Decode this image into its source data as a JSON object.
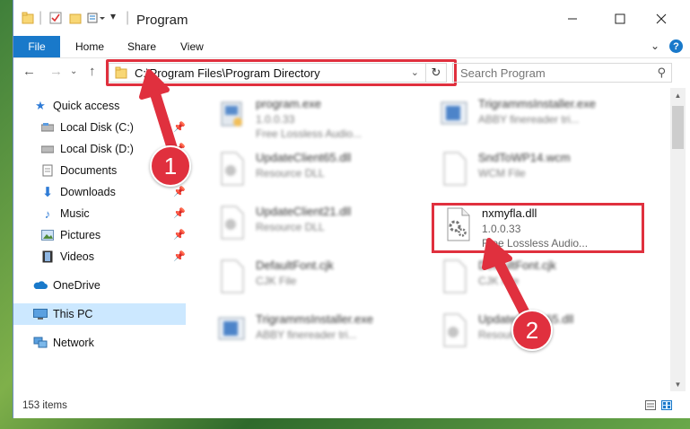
{
  "window": {
    "title": "Program",
    "controls": [
      "minimize-icon",
      "maximize-icon",
      "close-icon"
    ]
  },
  "ribbon": {
    "tabs": [
      "File",
      "Home",
      "Share",
      "View"
    ]
  },
  "navigation": {
    "address": "C:\\Program Files\\Program Directory",
    "search_placeholder": "Search Program"
  },
  "sidebar": {
    "items": [
      {
        "label": "Quick access",
        "icon": "star-icon",
        "pinned": false
      },
      {
        "label": "Local Disk (C:)",
        "icon": "drive-icon",
        "pinned": true
      },
      {
        "label": "Local Disk (D:)",
        "icon": "drive-icon",
        "pinned": true
      },
      {
        "label": "Documents",
        "icon": "documents-icon",
        "pinned": true
      },
      {
        "label": "Downloads",
        "icon": "download-icon",
        "pinned": true
      },
      {
        "label": "Music",
        "icon": "music-icon",
        "pinned": true
      },
      {
        "label": "Pictures",
        "icon": "pictures-icon",
        "pinned": true
      },
      {
        "label": "Videos",
        "icon": "videos-icon",
        "pinned": true
      },
      {
        "label": "OneDrive",
        "icon": "cloud-icon",
        "pinned": false
      },
      {
        "label": "This PC",
        "icon": "computer-icon",
        "pinned": false,
        "selected": true
      },
      {
        "label": "Network",
        "icon": "network-icon",
        "pinned": false
      }
    ]
  },
  "files": [
    {
      "name": "program.exe",
      "meta1": "1.0.0.33",
      "meta2": "Free Lossless Audio...",
      "icon": "exe-icon"
    },
    {
      "name": "TrigrammsInstaller.exe",
      "meta1": "ABBY finereader tri...",
      "icon": "installer-icon"
    },
    {
      "name": "UpdateClient65.dll",
      "meta1": "Resource DLL",
      "icon": "dll-icon"
    },
    {
      "name": "SndToWP14.wcm",
      "meta1": "WCM File",
      "icon": "file-icon"
    },
    {
      "name": "UpdateClient21.dll",
      "meta1": "Resource DLL",
      "icon": "dll-icon"
    },
    {
      "name": "nxmyfla.dll",
      "meta1": "1.0.0.33",
      "meta2": "Free Lossless Audio...",
      "icon": "dll-gear-icon",
      "highlighted": true
    },
    {
      "name": "DefaultFont.cjk",
      "meta1": "CJK File",
      "icon": "file-icon"
    },
    {
      "name": "DefaultFont.cjk",
      "meta1": "CJK File",
      "icon": "file-icon"
    },
    {
      "name": "TrigrammsInstaller.exe",
      "meta1": "ABBY finereader tri...",
      "icon": "installer-icon"
    },
    {
      "name": "UpdateClient65.dll",
      "meta1": "Resource DLL",
      "icon": "dll-icon"
    }
  ],
  "status": {
    "count": "153 items"
  },
  "callouts": [
    "1",
    "2"
  ],
  "colors": {
    "accent": "#1979ca",
    "highlight": "#e0303e",
    "selected": "#cce8ff"
  }
}
